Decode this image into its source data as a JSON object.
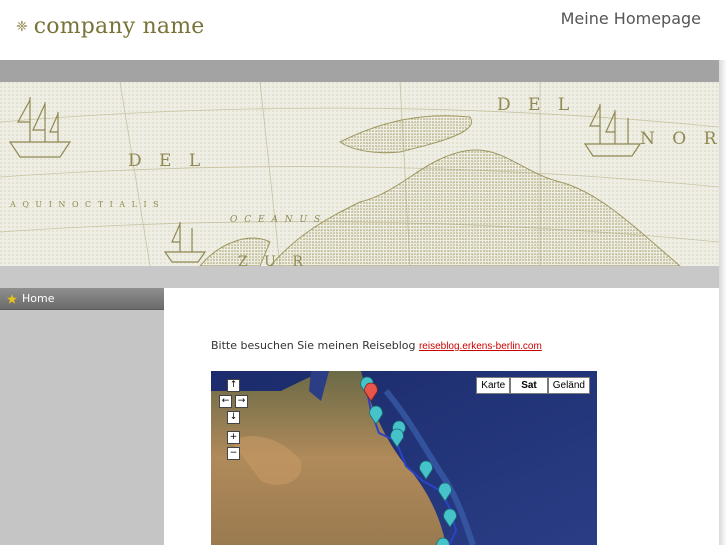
{
  "header": {
    "logo_text": "company name",
    "site_title": "Meine Homepage"
  },
  "banner": {
    "map_words": [
      "DEL",
      "NOR",
      "DEL",
      "AQUINOCTIALIS",
      "OCEANUS",
      "ZUR"
    ]
  },
  "sidebar": {
    "items": [
      {
        "label": "Home",
        "icon": "star-icon"
      }
    ]
  },
  "content": {
    "intro_text": "Bitte besuchen Sie meinen Reiseblog ",
    "link_text": "reiseblog.erkens-berlin.com",
    "map": {
      "controls": [
        "pan-up",
        "pan-left",
        "pan-right",
        "pan-down",
        "zoom-in",
        "zoom-out"
      ],
      "type_buttons": [
        "Karte",
        "Sat",
        "Geländ"
      ],
      "active_type": "Sat"
    }
  },
  "colors": {
    "logo": "#7a7338",
    "band_top": "#a3a3a3",
    "band_bottom": "#c8c8c8",
    "sidebar": "#c5c5c5",
    "link": "#cc0000",
    "marker_selected": "#e8554a",
    "marker": "#45c3c9",
    "route": "#2a43c6"
  }
}
